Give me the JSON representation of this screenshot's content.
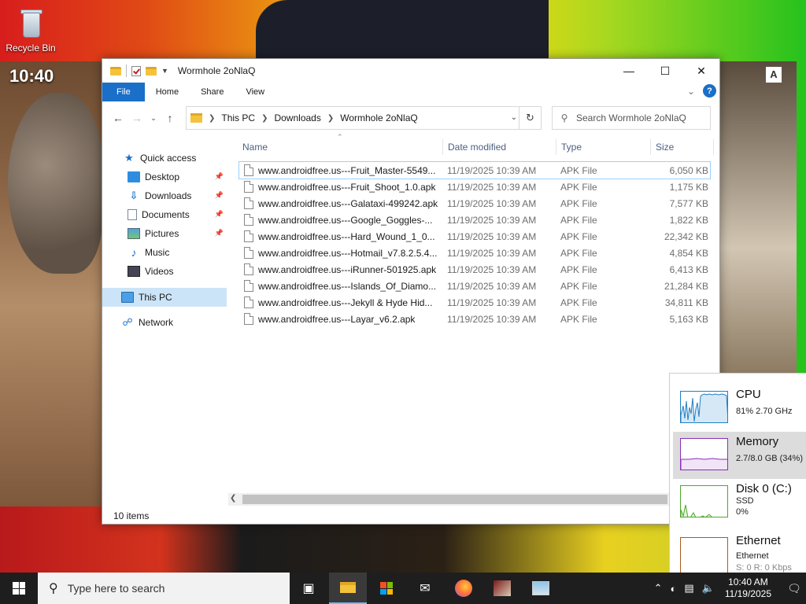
{
  "desktop": {
    "recycle_bin_label": "Recycle Bin",
    "overlay_time": "10:40",
    "overlay_badge": "A"
  },
  "explorer": {
    "title": "Wormhole 2oNlaQ",
    "ribbon_tabs": [
      "File",
      "Home",
      "Share",
      "View"
    ],
    "breadcrumb": [
      "This PC",
      "Downloads",
      "Wormhole 2oNlaQ"
    ],
    "search_placeholder": "Search Wormhole 2oNlaQ",
    "nav": {
      "quick_access": "Quick access",
      "desktop": "Desktop",
      "downloads": "Downloads",
      "documents": "Documents",
      "pictures": "Pictures",
      "music": "Music",
      "videos": "Videos",
      "this_pc": "This PC",
      "network": "Network"
    },
    "columns": {
      "name": "Name",
      "date": "Date modified",
      "type": "Type",
      "size": "Size"
    },
    "files": [
      {
        "name": "www.androidfree.us---Fruit_Master-5549...",
        "date": "11/19/2025 10:39 AM",
        "type": "APK File",
        "size": "6,050 KB"
      },
      {
        "name": "www.androidfree.us---Fruit_Shoot_1.0.apk",
        "date": "11/19/2025 10:39 AM",
        "type": "APK File",
        "size": "1,175 KB"
      },
      {
        "name": "www.androidfree.us---Galataxi-499242.apk",
        "date": "11/19/2025 10:39 AM",
        "type": "APK File",
        "size": "7,577 KB"
      },
      {
        "name": "www.androidfree.us---Google_Goggles-...",
        "date": "11/19/2025 10:39 AM",
        "type": "APK File",
        "size": "1,822 KB"
      },
      {
        "name": "www.androidfree.us---Hard_Wound_1_0...",
        "date": "11/19/2025 10:39 AM",
        "type": "APK File",
        "size": "22,342 KB"
      },
      {
        "name": "www.androidfree.us---Hotmail_v7.8.2.5.4...",
        "date": "11/19/2025 10:39 AM",
        "type": "APK File",
        "size": "4,854 KB"
      },
      {
        "name": "www.androidfree.us---iRunner-501925.apk",
        "date": "11/19/2025 10:39 AM",
        "type": "APK File",
        "size": "6,413 KB"
      },
      {
        "name": "www.androidfree.us---Islands_Of_Diamo...",
        "date": "11/19/2025 10:39 AM",
        "type": "APK File",
        "size": "21,284 KB"
      },
      {
        "name": "www.androidfree.us---Jekyll & Hyde Hid...",
        "date": "11/19/2025 10:39 AM",
        "type": "APK File",
        "size": "34,811 KB"
      },
      {
        "name": "www.androidfree.us---Layar_v6.2.apk",
        "date": "11/19/2025 10:39 AM",
        "type": "APK File",
        "size": "5,163 KB"
      }
    ],
    "status": "10 items"
  },
  "perf": {
    "cpu": {
      "title": "CPU",
      "sub": "81%  2.70 GHz",
      "color": "#1f7fc3"
    },
    "memory": {
      "title": "Memory",
      "sub": "2.7/8.0 GB (34%)",
      "color": "#8b2fb5"
    },
    "disk": {
      "title": "Disk 0 (C:)",
      "sub1": "SSD",
      "sub2": "0%",
      "color": "#4da82b"
    },
    "ethernet": {
      "title": "Ethernet",
      "sub1": "Ethernet",
      "sub2": "S: 0 R: 0 Kbps",
      "color": "#a85c1f"
    }
  },
  "taskbar": {
    "search_placeholder": "Type here to search",
    "time": "10:40 AM",
    "date": "11/19/2025"
  }
}
